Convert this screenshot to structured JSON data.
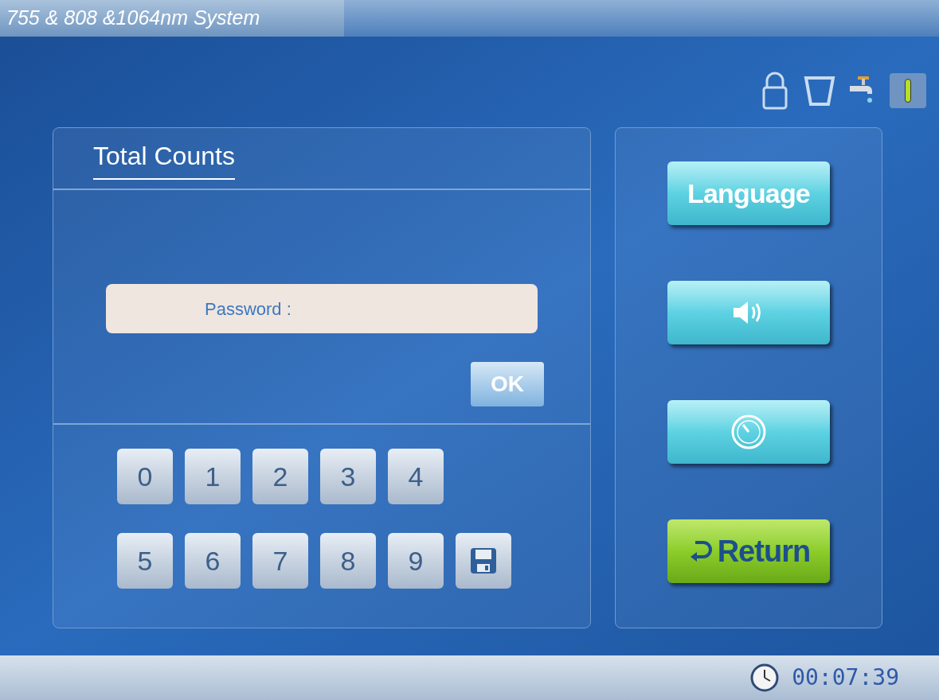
{
  "window": {
    "title": "755 & 808 &1064nm System"
  },
  "panel": {
    "title": "Total Counts",
    "password_label": "Password :",
    "ok": "OK",
    "keys": [
      {
        "kind": "digit",
        "label": "0"
      },
      {
        "kind": "digit",
        "label": "1"
      },
      {
        "kind": "digit",
        "label": "2"
      },
      {
        "kind": "digit",
        "label": "3"
      },
      {
        "kind": "digit",
        "label": "4"
      },
      {
        "kind": "digit",
        "label": "5"
      },
      {
        "kind": "digit",
        "label": "6"
      },
      {
        "kind": "digit",
        "label": "7"
      },
      {
        "kind": "digit",
        "label": "8"
      },
      {
        "kind": "digit",
        "label": "9"
      },
      {
        "kind": "save"
      }
    ]
  },
  "side_buttons": [
    {
      "kind": "text",
      "label": "Language"
    },
    {
      "kind": "sound"
    },
    {
      "kind": "gauge"
    },
    {
      "kind": "return",
      "label": "Return"
    }
  ],
  "status_bar": {
    "time": "00:07:39"
  }
}
